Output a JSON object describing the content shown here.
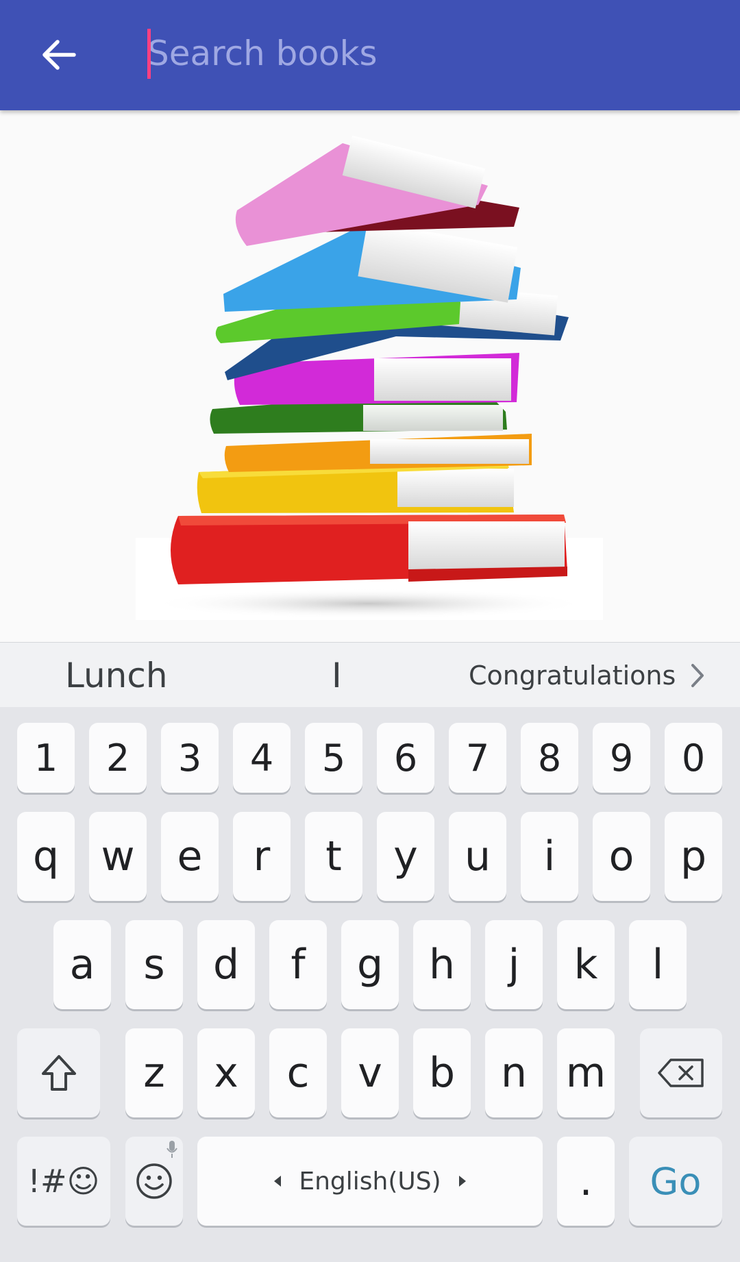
{
  "search": {
    "placeholder": "Search books",
    "value": ""
  },
  "icons": {
    "back": "arrow-back-icon",
    "books": "book-stack-image",
    "suggest_more": "chevron-right-icon",
    "shift": "shift-icon",
    "backspace": "backspace-icon",
    "emoji": "emoji-icon",
    "mic": "mic-icon",
    "lang_left": "triangle-left-icon",
    "lang_right": "triangle-right-icon"
  },
  "suggestions": [
    "Lunch",
    "I",
    "Congratulations"
  ],
  "keyboard": {
    "numbers": [
      "1",
      "2",
      "3",
      "4",
      "5",
      "6",
      "7",
      "8",
      "9",
      "0"
    ],
    "row1": [
      "q",
      "w",
      "e",
      "r",
      "t",
      "y",
      "u",
      "i",
      "o",
      "p"
    ],
    "row2": [
      "a",
      "s",
      "d",
      "f",
      "g",
      "h",
      "j",
      "k",
      "l"
    ],
    "row3": [
      "z",
      "x",
      "c",
      "v",
      "b",
      "n",
      "m"
    ],
    "symbols_label": "!#☺",
    "space_label": "English(US)",
    "period_label": ".",
    "action_label": "Go"
  },
  "colors": {
    "appbar": "#3f51b5",
    "cursor": "#ff4081",
    "go": "#3a8fb7"
  }
}
